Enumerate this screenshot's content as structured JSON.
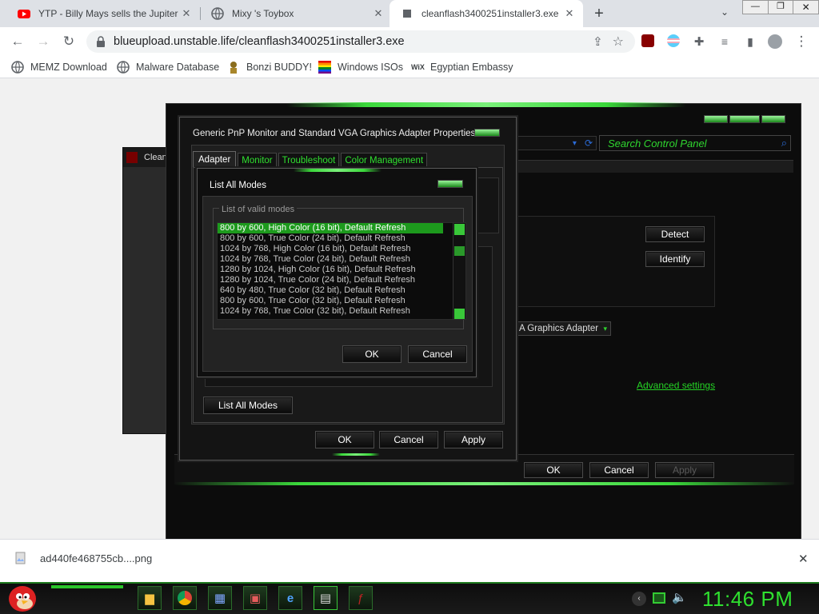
{
  "browser": {
    "tabs": [
      {
        "title": "YTP - Billy Mays sells the Jupiter",
        "icon": "youtube-icon"
      },
      {
        "title": "Mixy 's Toybox",
        "icon": "globe-icon"
      },
      {
        "title": "cleanflash3400251installer3.exe",
        "icon": "file-icon"
      }
    ],
    "url": "blueupload.unstable.life/cleanflash3400251installer3.exe",
    "bookmarks": [
      {
        "label": "MEMZ Download",
        "icon": "globe-icon"
      },
      {
        "label": "Malware Database",
        "icon": "globe-icon"
      },
      {
        "label": "Bonzi BUDDY!",
        "icon": "bonzi-icon"
      },
      {
        "label": "Windows ISOs",
        "icon": "windows-flag-icon"
      },
      {
        "label": "Egyptian Embassy",
        "icon": "wix-icon"
      }
    ],
    "download": {
      "filename": "ad440fe468755cb....png"
    }
  },
  "installer": {
    "title_partial": "Clean"
  },
  "control_panel": {
    "search_placeholder": "Search Control Panel",
    "detect_label": "Detect",
    "identify_label": "Identify",
    "adapter_select": "A Graphics Adapter",
    "advanced_link": "Advanced settings",
    "ok": "OK",
    "cancel": "Cancel",
    "apply": "Apply"
  },
  "properties": {
    "title": "Generic PnP Monitor and Standard VGA Graphics Adapter Properties",
    "tabs": [
      "Adapter",
      "Monitor",
      "Troubleshoot",
      "Color Management"
    ],
    "list_all_modes": "List All Modes",
    "ok": "OK",
    "cancel": "Cancel",
    "apply": "Apply"
  },
  "list_modes": {
    "title": "List All Modes",
    "group_label": "List of valid modes",
    "modes": [
      "800 by 600, High Color (16 bit), Default Refresh",
      "800 by 600, True Color (24 bit), Default Refresh",
      "1024 by 768, High Color (16 bit), Default Refresh",
      "1024 by 768, True Color (24 bit), Default Refresh",
      "1280 by 1024, High Color (16 bit), Default Refresh",
      "1280 by 1024, True Color (24 bit), Default Refresh",
      "640 by 480, True Color (32 bit), Default Refresh",
      "800 by 600, True Color (32 bit), Default Refresh",
      "1024 by 768, True Color (32 bit), Default Refresh"
    ],
    "ok": "OK",
    "cancel": "Cancel"
  },
  "taskbar": {
    "clock": "11:46 PM",
    "items": [
      "folder-icon",
      "chrome-icon",
      "control-panel-icon",
      "installer-icon",
      "ie-icon",
      "display-icon",
      "flash-icon"
    ]
  },
  "colors": {
    "accent_green": "#2ac52a",
    "dark_bg": "#0c0c0c",
    "chrome_tab_bg": "#dee1e6"
  }
}
